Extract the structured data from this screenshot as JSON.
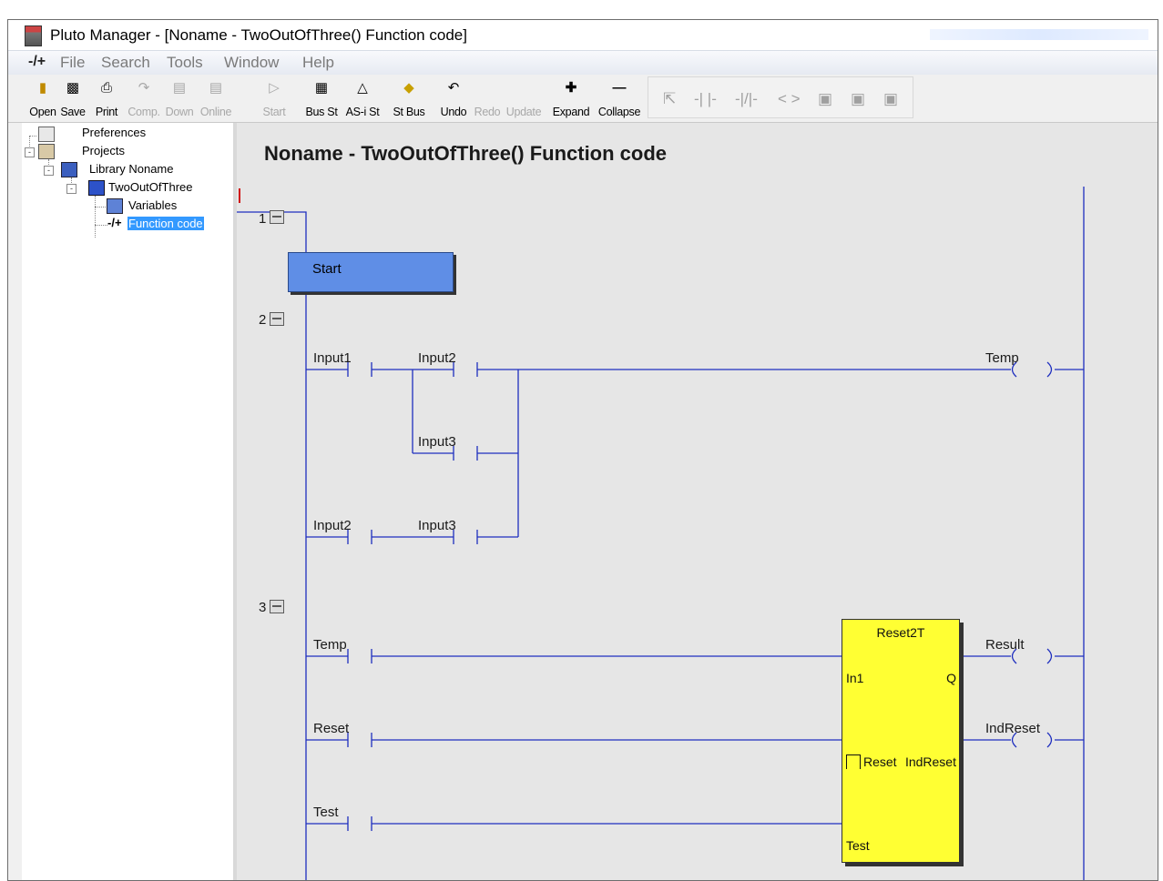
{
  "window": {
    "title": "Pluto Manager - [Noname - TwoOutOfThree() Function code]"
  },
  "menu": [
    "File",
    "Search",
    "Tools",
    "Window",
    "Help"
  ],
  "toolbar": {
    "buttons": [
      {
        "label": "Open",
        "enabled": true
      },
      {
        "label": "Save",
        "enabled": true
      },
      {
        "label": "Print",
        "enabled": true
      },
      {
        "label": "Comp.",
        "enabled": false
      },
      {
        "label": "Down",
        "enabled": false
      },
      {
        "label": "Online",
        "enabled": false
      },
      {
        "label": "Start",
        "enabled": false
      },
      {
        "label": "Bus St",
        "enabled": true
      },
      {
        "label": "AS-i St",
        "enabled": true
      },
      {
        "label": "St Bus",
        "enabled": true
      },
      {
        "label": "Undo",
        "enabled": true
      },
      {
        "label": "Redo",
        "enabled": false
      },
      {
        "label": "Update",
        "enabled": false
      },
      {
        "label": "Expand",
        "enabled": true
      },
      {
        "label": "Collapse",
        "enabled": true
      }
    ]
  },
  "tree": {
    "preferences": "Preferences",
    "projects": "Projects",
    "library": "Library Noname",
    "function": "TwoOutOfThree",
    "variables": "Variables",
    "function_code": "Function code"
  },
  "editor": {
    "heading": "Noname - TwoOutOfThree() Function code",
    "rungs": [
      {
        "number": "1",
        "start_block": "Start"
      },
      {
        "number": "2",
        "contacts": [
          "Input1",
          "Input2",
          "Input3",
          "Input2",
          "Input3"
        ],
        "coil": "Temp"
      },
      {
        "number": "3",
        "contacts": [
          "Temp",
          "Reset",
          "Test"
        ],
        "coils": [
          "Result",
          "IndReset"
        ]
      }
    ],
    "function_block": {
      "name": "Reset2T",
      "inputs": [
        "In1",
        "Reset",
        "Test"
      ],
      "outputs": [
        "Q",
        "IndReset"
      ]
    }
  },
  "colors": {
    "ladder_line": "#1f2fbf",
    "start_block": "#5f8ee6",
    "function_block": "#ffff33",
    "selection": "#3399ff"
  }
}
